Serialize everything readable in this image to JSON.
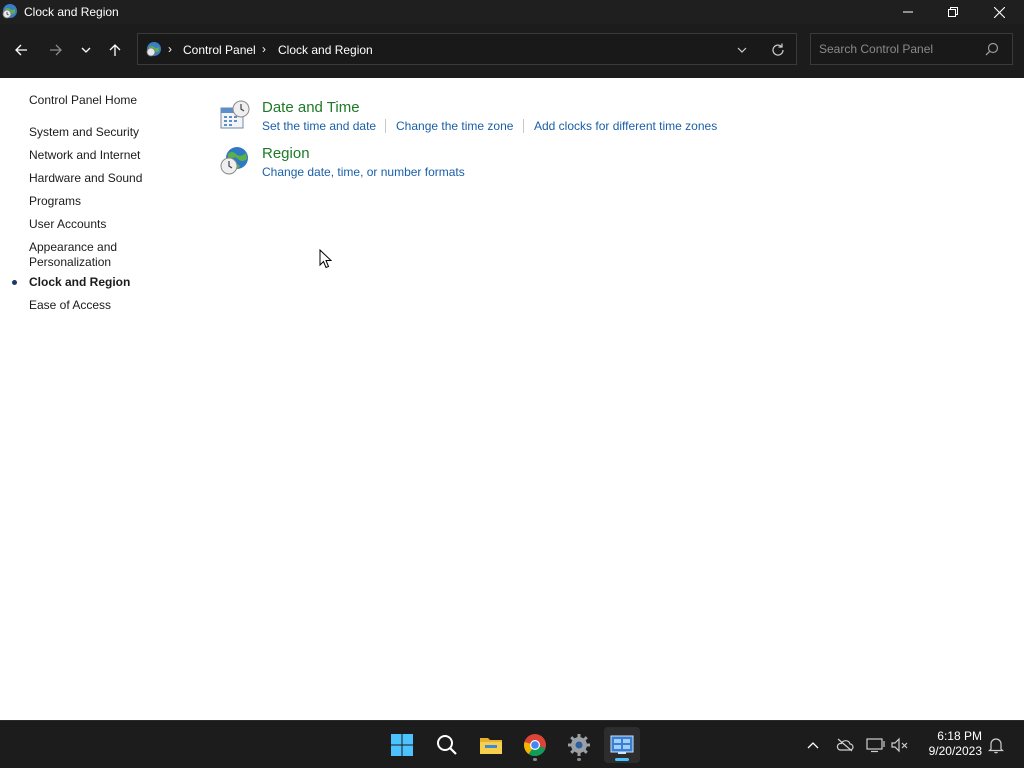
{
  "window": {
    "title": "Clock and Region"
  },
  "address": {
    "breadcrumb": [
      "Control Panel",
      "Clock and Region"
    ]
  },
  "search": {
    "placeholder": "Search Control Panel"
  },
  "sidebar": {
    "home": "Control Panel Home",
    "items": [
      {
        "label": "System and Security"
      },
      {
        "label": "Network and Internet"
      },
      {
        "label": "Hardware and Sound"
      },
      {
        "label": "Programs"
      },
      {
        "label": "User Accounts"
      },
      {
        "label": "Appearance and Personalization"
      },
      {
        "label": "Clock and Region",
        "active": true
      },
      {
        "label": "Ease of Access"
      }
    ]
  },
  "categories": [
    {
      "title": "Date and Time",
      "icon": "calendar-clock-icon",
      "links": [
        "Set the time and date",
        "Change the time zone",
        "Add clocks for different time zones"
      ]
    },
    {
      "title": "Region",
      "icon": "globe-clock-icon",
      "links": [
        "Change date, time, or number formats"
      ]
    }
  ],
  "taskbar": {
    "apps": [
      "start-icon",
      "search-icon",
      "file-explorer-icon",
      "chrome-icon",
      "settings-icon",
      "control-panel-icon"
    ],
    "active_app": "control-panel-icon"
  },
  "clock": {
    "time": "6:18 PM",
    "date": "9/20/2023"
  },
  "colors": {
    "link": "#1a5fa8",
    "category_title": "#1e7a28",
    "accent": "#4cc2ff"
  }
}
